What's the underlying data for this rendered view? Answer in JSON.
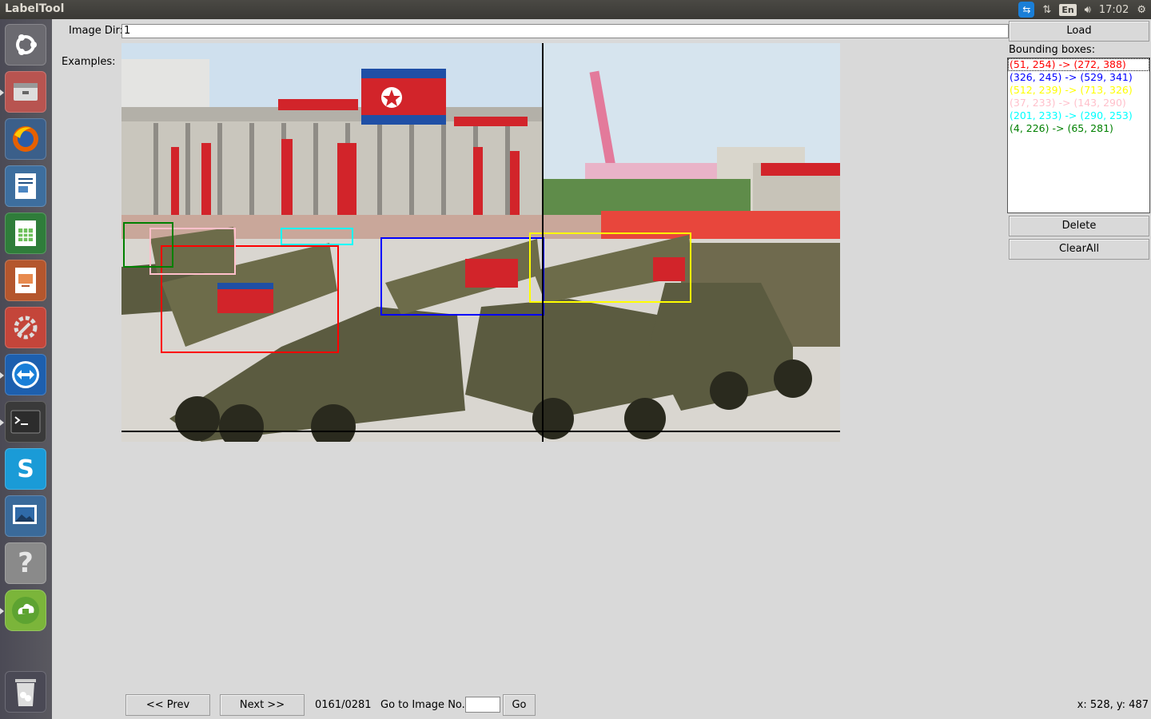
{
  "window": {
    "title": "LabelTool"
  },
  "tray": {
    "keyboard": "En",
    "time": "17:02"
  },
  "launcher": {
    "items": [
      "ubuntu-dash",
      "files",
      "firefox",
      "writer",
      "calc",
      "impress",
      "system-settings",
      "teamviewer",
      "terminal",
      "skype",
      "image-viewer",
      "help",
      "cloud-storage",
      "trash"
    ]
  },
  "form": {
    "image_dir_label": "Image Dir:",
    "image_dir_value": "1",
    "examples_label": "Examples:"
  },
  "right_panel": {
    "load_label": "Load",
    "bbox_title": "Bounding boxes:",
    "boxes": [
      {
        "text": "(51, 254) -> (272, 388)",
        "color": "#ff0000"
      },
      {
        "text": "(326, 245) -> (529, 341)",
        "color": "#0000ff"
      },
      {
        "text": "(512, 239) -> (713, 326)",
        "color": "#ffff00"
      },
      {
        "text": "(37, 233) -> (143, 290)",
        "color": "#ffc0cb"
      },
      {
        "text": "(201, 233) -> (290, 253)",
        "color": "#00ffff"
      },
      {
        "text": "(4, 226) -> (65, 281)",
        "color": "#008000"
      }
    ],
    "delete_label": "Delete",
    "clearall_label": "ClearAll"
  },
  "nav": {
    "prev_label": "<< Prev",
    "next_label": "Next >>",
    "progress": "0161/0281",
    "goto_label": "Go to Image No.",
    "go_label": "Go"
  },
  "cursor_readout": "x: 528, y: 487"
}
